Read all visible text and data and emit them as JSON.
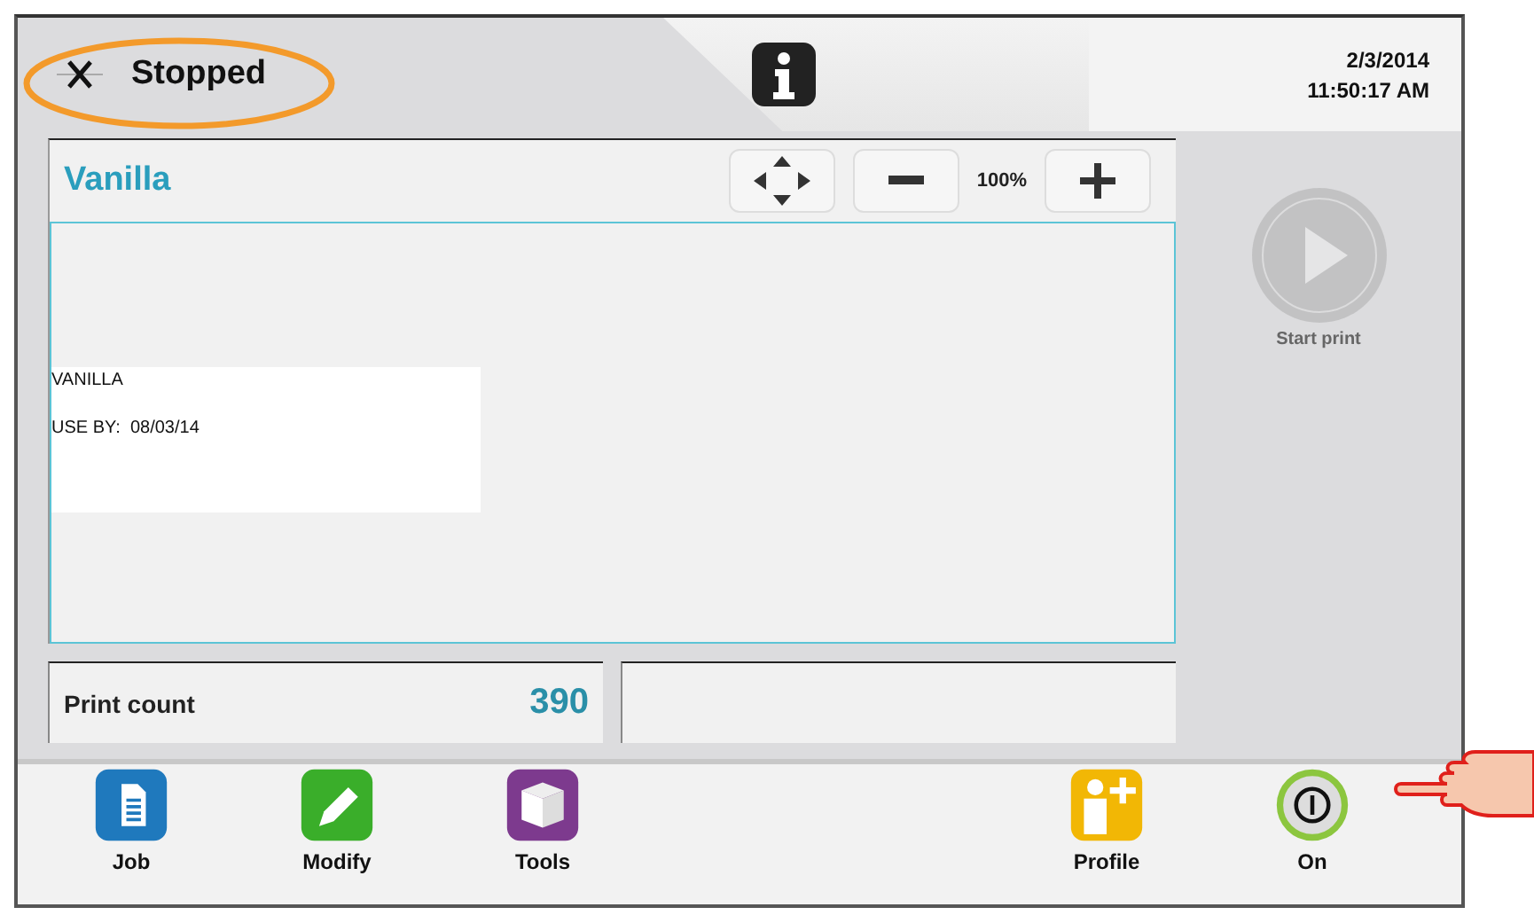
{
  "status": {
    "kind": "stopped",
    "label": "Stopped"
  },
  "datetime": {
    "date": "2/3/2014",
    "time": "11:50:17 AM"
  },
  "job": {
    "name": "Vanilla",
    "zoom": "100%"
  },
  "label_preview": {
    "lines": [
      "VANILLA",
      "USE BY:  08/03/14"
    ]
  },
  "start_print": {
    "label": "Start print",
    "disabled": true
  },
  "counters": [
    {
      "label": "Print count",
      "value": "390"
    }
  ],
  "toolbar": [
    {
      "kind": "job",
      "label": "Job"
    },
    {
      "kind": "modify",
      "label": "Modify"
    },
    {
      "kind": "tools",
      "label": "Tools"
    },
    {
      "kind": "spacer"
    },
    {
      "kind": "profile",
      "label": "Profile"
    },
    {
      "kind": "power",
      "label": "On"
    }
  ]
}
